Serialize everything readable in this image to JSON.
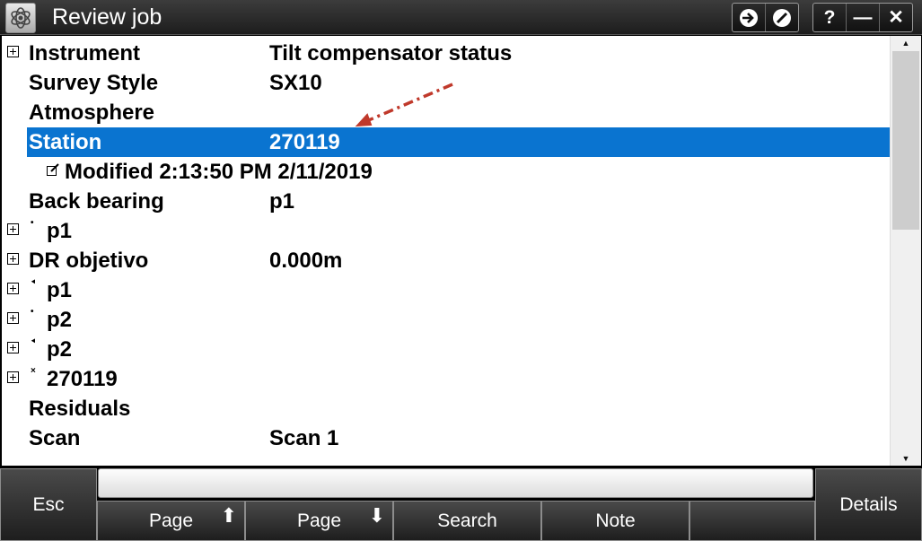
{
  "window": {
    "title": "Review job",
    "buttons": {
      "enter": "➜",
      "stop": "⊘",
      "help": "?",
      "minimize": "—",
      "close": "✕"
    }
  },
  "rows": [
    {
      "name": "Instrument",
      "value": "Tilt compensator status",
      "expandable": true
    },
    {
      "name": "Survey Style",
      "value": "SX10"
    },
    {
      "name": "Atmosphere",
      "value": ""
    },
    {
      "name": "Station",
      "value": "270119",
      "selected": true
    },
    {
      "name": "Modified 2:13:50 PM 2/11/2019",
      "value": "",
      "note_icon": true
    },
    {
      "name": "Back bearing",
      "value": "p1"
    },
    {
      "name": "p1",
      "value": "",
      "expandable": true,
      "point_marker": "•"
    },
    {
      "name": "DR objetivo",
      "value": "0.000m",
      "expandable": true
    },
    {
      "name": "p1",
      "value": "",
      "expandable": true,
      "point_marker": "⯇"
    },
    {
      "name": "p2",
      "value": "",
      "expandable": true,
      "point_marker": "•"
    },
    {
      "name": "p2",
      "value": "",
      "expandable": true,
      "point_marker": "⯇"
    },
    {
      "name": "270119",
      "value": "",
      "expandable": true,
      "point_marker": "×"
    },
    {
      "name": "Residuals",
      "value": ""
    },
    {
      "name": "Scan",
      "value": "Scan 1"
    }
  ],
  "softkeys": {
    "esc": "Esc",
    "page_up": "Page",
    "page_down": "Page",
    "search": "Search",
    "note": "Note",
    "details": "Details",
    "arrow_up": "⬆",
    "arrow_down": "⬇"
  },
  "colors": {
    "selection": "#0a74d0",
    "annotation_arrow": "#c0392b"
  }
}
